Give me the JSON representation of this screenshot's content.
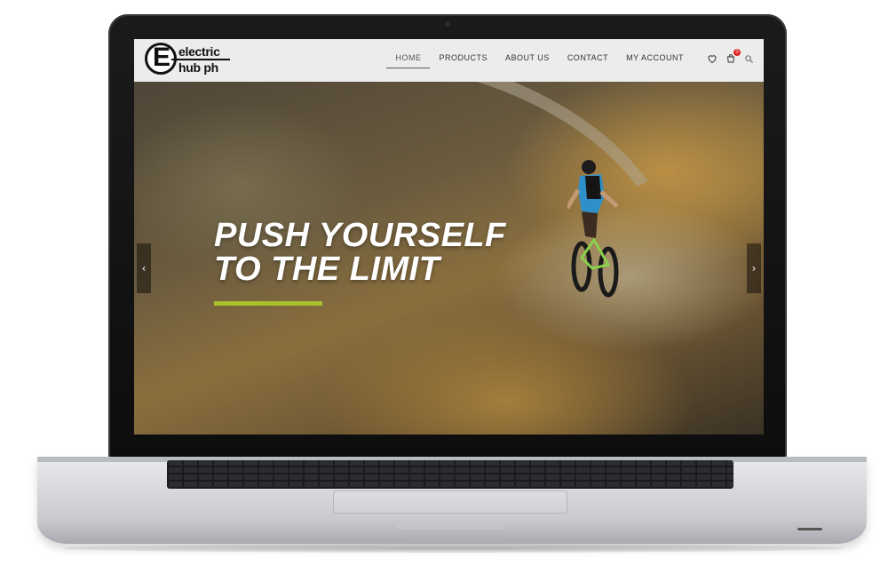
{
  "site": {
    "logo": {
      "line1": "electric",
      "line2": "hub ph",
      "mark": "E"
    },
    "nav": [
      {
        "label": "HOME",
        "active": true
      },
      {
        "label": "PRODUCTS",
        "active": false
      },
      {
        "label": "ABOUT US",
        "active": false
      },
      {
        "label": "CONTACT",
        "active": false
      },
      {
        "label": "MY ACCOUNT",
        "active": false
      }
    ],
    "icons": {
      "wishlist": "heart-icon",
      "cart": "cart-icon",
      "search": "search-icon"
    },
    "cart_count": "0"
  },
  "hero": {
    "title_line1": "PUSH YOURSELF",
    "title_line2": "TO THE LIMIT",
    "accent_color": "#a9c12a",
    "prev_arrow": "‹",
    "next_arrow": "›"
  },
  "colors": {
    "header_bg": "#ececec",
    "cart_badge": "#e02020"
  }
}
